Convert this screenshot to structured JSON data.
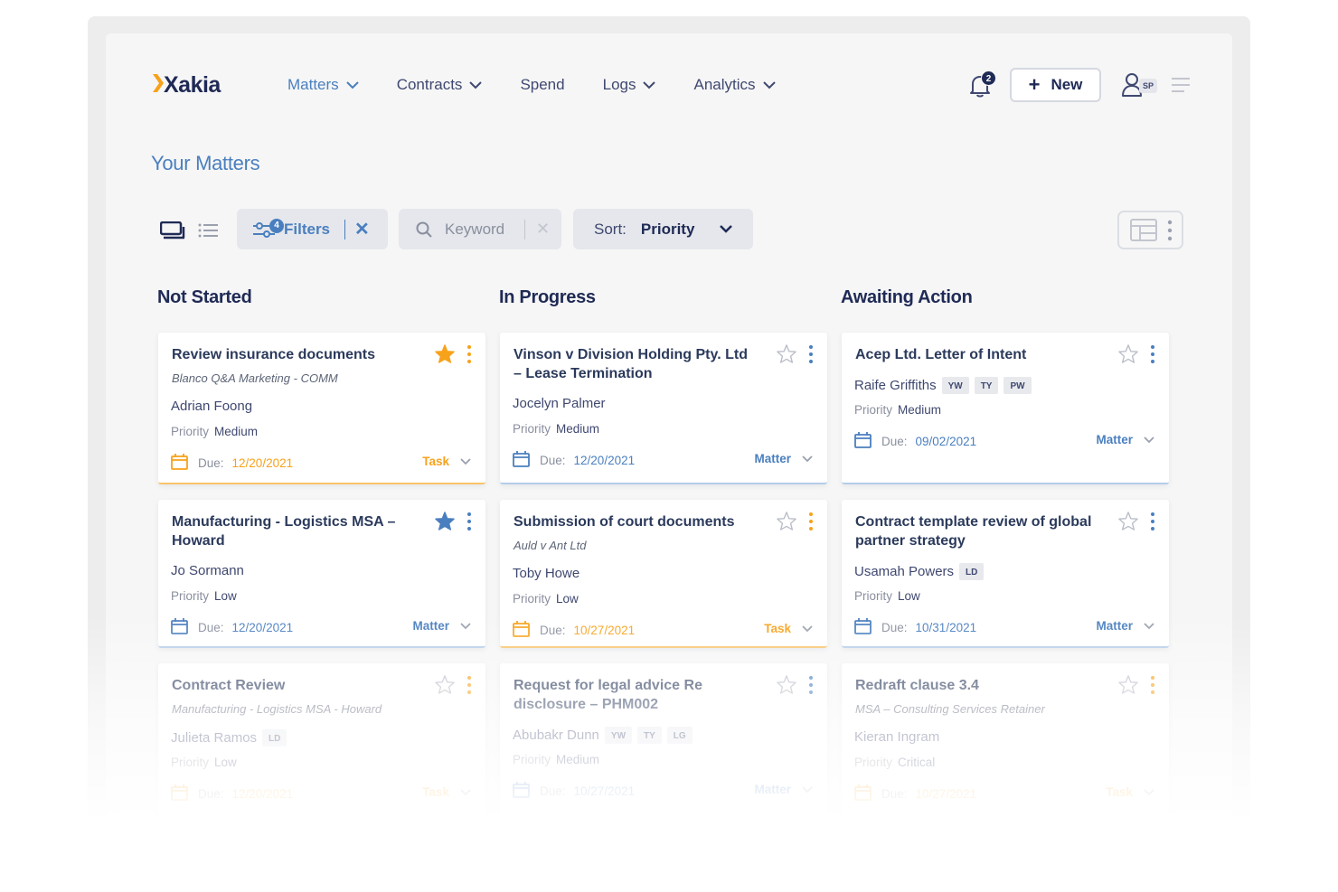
{
  "app": {
    "logo": "Xakia"
  },
  "nav": {
    "items": [
      {
        "label": "Matters",
        "dropdown": true,
        "active": true
      },
      {
        "label": "Contracts",
        "dropdown": true
      },
      {
        "label": "Spend",
        "dropdown": false
      },
      {
        "label": "Logs",
        "dropdown": true
      },
      {
        "label": "Analytics",
        "dropdown": true
      }
    ],
    "notification_count": "2",
    "new_label": "New",
    "user_initials": "SP"
  },
  "page": {
    "title": "Your Matters"
  },
  "toolbar": {
    "filters_label": "Filters",
    "filters_count": "4",
    "keyword_placeholder": "Keyword",
    "sort_label": "Sort:",
    "sort_value": "Priority"
  },
  "colors": {
    "accent_blue": "#4a7fbf",
    "accent_orange": "#f7a21b",
    "navy": "#1f2a55"
  },
  "columns": [
    {
      "title": "Not Started",
      "cards": [
        {
          "title": "Review insurance documents",
          "subtitle": "Blanco Q&A Marketing - COMM",
          "person": "Adrian Foong",
          "tags": [],
          "priority_label": "Priority",
          "priority": "Medium",
          "due_label": "Due:",
          "due": "12/20/2021",
          "type": "Task",
          "starred": true
        },
        {
          "title": "Manufacturing - Logistics MSA – Howard",
          "subtitle": "",
          "person": "Jo Sormann",
          "tags": [],
          "priority_label": "Priority",
          "priority": "Low",
          "due_label": "Due:",
          "due": "12/20/2021",
          "type": "Matter",
          "starred": true
        },
        {
          "title": "Contract Review",
          "subtitle": "Manufacturing - Logistics MSA - Howard",
          "person": "Julieta Ramos",
          "tags": [
            "LD"
          ],
          "priority_label": "Priority",
          "priority": "Low",
          "due_label": "Due:",
          "due": "12/20/2021",
          "type": "Task",
          "starred": false
        }
      ]
    },
    {
      "title": "In Progress",
      "cards": [
        {
          "title": "Vinson v Division Holding Pty. Ltd – Lease Termination",
          "subtitle": "",
          "person": "Jocelyn Palmer",
          "tags": [],
          "priority_label": "Priority",
          "priority": "Medium",
          "due_label": "Due:",
          "due": "12/20/2021",
          "type": "Matter",
          "starred": false
        },
        {
          "title": "Submission of court documents",
          "subtitle": "Auld v Ant Ltd",
          "person": "Toby Howe",
          "tags": [],
          "priority_label": "Priority",
          "priority": "Low",
          "due_label": "Due:",
          "due": "10/27/2021",
          "type": "Task",
          "starred": false
        },
        {
          "title": "Request for legal advice Re disclosure – PHM002",
          "subtitle": "",
          "person": "Abubakr Dunn",
          "tags": [
            "YW",
            "TY",
            "LG"
          ],
          "priority_label": "Priority",
          "priority": "Medium",
          "due_label": "Due:",
          "due": "10/27/2021",
          "type": "Matter",
          "starred": false
        }
      ]
    },
    {
      "title": "Awaiting Action",
      "cards": [
        {
          "title": "Acep Ltd. Letter of Intent",
          "subtitle": "",
          "person": "Raife Griffiths",
          "tags": [
            "YW",
            "TY",
            "PW"
          ],
          "priority_label": "Priority",
          "priority": "Medium",
          "due_label": "Due:",
          "due": "09/02/2021",
          "type": "Matter",
          "starred": false
        },
        {
          "title": "Contract template review of global partner strategy",
          "subtitle": "",
          "person": "Usamah Powers",
          "tags": [
            "LD"
          ],
          "priority_label": "Priority",
          "priority": "Low",
          "due_label": "Due:",
          "due": "10/31/2021",
          "type": "Matter",
          "starred": false
        },
        {
          "title": "Redraft clause 3.4",
          "subtitle": "MSA – Consulting Services Retainer",
          "person": "Kieran Ingram",
          "tags": [],
          "priority_label": "Priority",
          "priority": "Critical",
          "due_label": "Due:",
          "due": "10/27/2021",
          "type": "Task",
          "starred": false
        }
      ]
    }
  ]
}
